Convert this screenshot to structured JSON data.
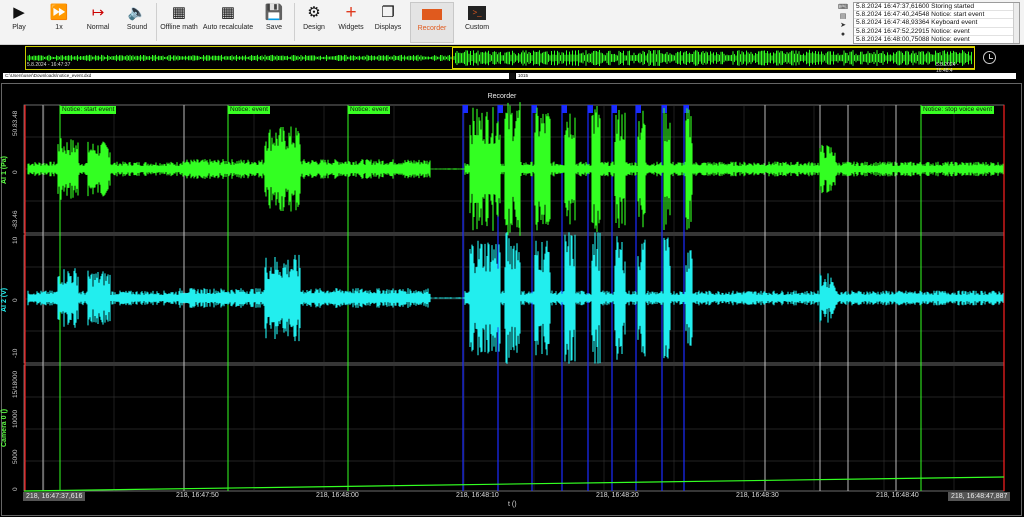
{
  "toolbar": {
    "play": "Play",
    "speed": "1x",
    "normal": "Normal",
    "sound": "Sound",
    "offline_math": "Offline math",
    "auto_recalculate": "Auto recalculate",
    "save": "Save",
    "design": "Design",
    "widgets": "Widgets",
    "displays": "Displays",
    "recorder": "Recorder",
    "custom": "Custom"
  },
  "event_log": [
    "5.8.2024 16:47:37,61600 Storing started",
    "5.8.2024 16:47:40,24548 Notice: start event",
    "5.8.2024 16:47:48,93364 Keyboard event",
    "5.8.2024 16:47:52,22915 Notice: event",
    "5.8.2024 16:48:00,75088 Notice: event"
  ],
  "overview": {
    "start_time": "5.8.2024 - 16:47:37",
    "end_time": "5.8.2024 - 16:48:4"
  },
  "file": {
    "path": "C:\\Users\\user\\Downloads\\notice_event.dxd",
    "index": "1015"
  },
  "recorder": {
    "title": "Recorder",
    "channels": [
      {
        "name": "AI 1 (Pa)",
        "color": "#33ff22",
        "ticks": [
          "50.83.48",
          "0",
          "-83.46"
        ]
      },
      {
        "name": "AI 2 (V)",
        "color": "#22eeee",
        "ticks": [
          "10",
          "0",
          "-10"
        ]
      },
      {
        "name": "Camera 0 ()",
        "color": "#33ff22",
        "ticks": [
          "15/18000",
          "10000",
          "5000",
          "0"
        ]
      }
    ],
    "events": [
      "Notice: start event",
      "Notice: event",
      "Notice: event",
      "Notice: stop voice event"
    ],
    "x_ticks": [
      "218, 16:47:37,616",
      "218, 16:47:50",
      "218, 16:48:00",
      "218, 16:48:10",
      "218, 16:48:20",
      "218, 16:48:30",
      "218, 16:48:40",
      "218, 16:48:47,887"
    ],
    "x_label": "t ()"
  },
  "colors": {
    "green": "#33ff22",
    "cyan": "#22eeee",
    "blue_marker": "#1a2cff",
    "accent": "#e05a1e"
  }
}
